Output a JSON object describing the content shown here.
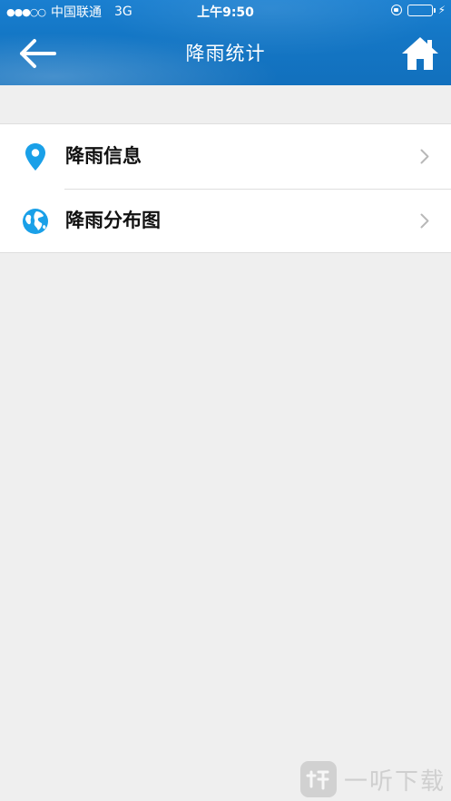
{
  "status_bar": {
    "signal": "●●●○○",
    "carrier": "中国联通",
    "network": "3G",
    "time": "上午9:50",
    "charge_symbol": "⚡"
  },
  "nav": {
    "title": "降雨统计",
    "back_icon": "arrow-left-icon",
    "home_icon": "home-icon"
  },
  "menu": {
    "items": [
      {
        "label": "降雨信息",
        "icon": "location-pin-icon"
      },
      {
        "label": "降雨分布图",
        "icon": "globe-icon"
      }
    ]
  },
  "watermark": {
    "text": "一听下载"
  },
  "colors": {
    "header": "#1477c6",
    "accent_icon": "#1aa0e8",
    "background": "#efefef",
    "battery": "#4cd964"
  }
}
